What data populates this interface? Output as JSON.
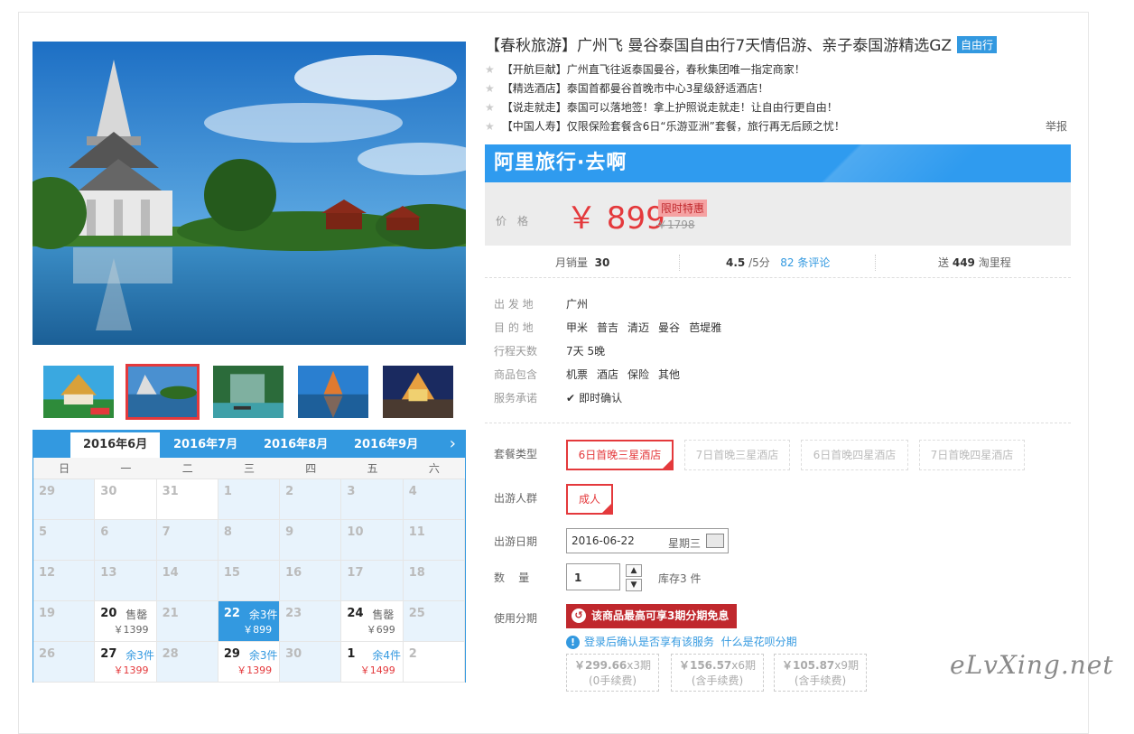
{
  "product": {
    "title": "【春秋旅游】广州飞 曼谷泰国自由行7天情侣游、亲子泰国游精选GZ",
    "tag": "自由行",
    "features": [
      "【开航巨献】广州直飞往返泰国曼谷，春秋集团唯一指定商家！",
      "【精选酒店】泰国首都曼谷首晚市中心3星级舒适酒店！",
      "【说走就走】泰国可以落地签！拿上护照说走就走！让自由行更自由！",
      "【中国人寿】仅限保险套餐含6日“乐游亚洲”套餐，旅行再无后顾之忧！"
    ],
    "report_label": "举报"
  },
  "brand": {
    "name": "阿里旅行·去啊"
  },
  "price": {
    "label": "价格",
    "value": "￥ 899",
    "promo": "限时特惠",
    "original": "￥1798"
  },
  "stats": {
    "sales_label": "月销量",
    "sales": "30",
    "rating": "4.5",
    "rating_max": "/5分",
    "reviews": "82 条评论",
    "miles_prefix": "送",
    "miles": "449",
    "miles_suffix": "淘里程"
  },
  "info": [
    {
      "label": "出 发 地",
      "values": [
        "广州"
      ]
    },
    {
      "label": "目 的 地",
      "values": [
        "甲米",
        "普吉",
        "清迈",
        "曼谷",
        "芭堤雅"
      ]
    },
    {
      "label": "行程天数",
      "values": [
        "7天 5晚"
      ]
    },
    {
      "label": "商品包含",
      "values": [
        "机票",
        "酒店",
        "保险",
        "其他"
      ]
    },
    {
      "label": "服务承诺",
      "values": [
        "即时确认"
      ]
    }
  ],
  "options": {
    "package_label": "套餐类型",
    "packages": [
      "6日首晚三星酒店",
      "7日首晚三星酒店",
      "6日首晚四星酒店",
      "7日首晚四星酒店"
    ],
    "people_label": "出游人群",
    "people": "成人",
    "date_label": "出游日期",
    "date": "2016-06-22",
    "weekday": "星期三",
    "qty_label": "数    量",
    "qty": "1",
    "stock": "库存3 件",
    "install_label": "使用分期",
    "install_btn": "该商品最高可享3期分期免息",
    "hint_text": "登录后确认是否享有该服务",
    "hint_link": "什么是花呗分期",
    "plans": [
      {
        "amount": "￥299.66",
        "term": "x3期",
        "fee": "(0手续费)"
      },
      {
        "amount": "￥156.57",
        "term": "x6期",
        "fee": "(含手续费)"
      },
      {
        "amount": "￥105.87",
        "term": "x9期",
        "fee": "(含手续费)"
      }
    ]
  },
  "calendar": {
    "months": [
      "2016年6月",
      "2016年7月",
      "2016年8月",
      "2016年9月"
    ],
    "next_icon": "chevron-right-icon",
    "weekdays": [
      "日",
      "一",
      "二",
      "三",
      "四",
      "五",
      "六"
    ],
    "cells": [
      {
        "d": "29",
        "off": true
      },
      {
        "d": "30",
        "off": false
      },
      {
        "d": "31",
        "off": false
      },
      {
        "d": "1",
        "off": true
      },
      {
        "d": "2",
        "off": true
      },
      {
        "d": "3",
        "off": true
      },
      {
        "d": "4",
        "off": true
      },
      {
        "d": "5",
        "off": true
      },
      {
        "d": "6",
        "off": true
      },
      {
        "d": "7",
        "off": true
      },
      {
        "d": "8",
        "off": true
      },
      {
        "d": "9",
        "off": true
      },
      {
        "d": "10",
        "off": true
      },
      {
        "d": "11",
        "off": true
      },
      {
        "d": "12",
        "off": true
      },
      {
        "d": "13",
        "off": true
      },
      {
        "d": "14",
        "off": true
      },
      {
        "d": "15",
        "off": true
      },
      {
        "d": "16",
        "off": true
      },
      {
        "d": "17",
        "off": true
      },
      {
        "d": "18",
        "off": true
      },
      {
        "d": "19",
        "off": true
      },
      {
        "d": "20",
        "avail": true,
        "status": "售罄",
        "price": "￥1399"
      },
      {
        "d": "21",
        "off": true
      },
      {
        "d": "22",
        "avail": true,
        "sel": true,
        "status": "余3件",
        "price": "￥899"
      },
      {
        "d": "23",
        "off": true
      },
      {
        "d": "24",
        "avail": true,
        "status": "售罄",
        "price": "￥699"
      },
      {
        "d": "25",
        "off": true
      },
      {
        "d": "26",
        "off": true
      },
      {
        "d": "27",
        "avail": true,
        "status": "余3件",
        "blue": true,
        "price": "￥1399",
        "red": true
      },
      {
        "d": "28",
        "off": true
      },
      {
        "d": "29",
        "avail": true,
        "status": "余3件",
        "blue": true,
        "price": "￥1399",
        "red": true
      },
      {
        "d": "30",
        "off": true
      },
      {
        "d": "1",
        "avail": true,
        "status": "余4件",
        "blue": true,
        "price": "￥1499",
        "red": true
      },
      {
        "d": "2",
        "off": false
      }
    ]
  },
  "watermark": "eLvXing.net",
  "colors": {
    "accent": "#3399e0",
    "price": "#e4393c",
    "brand_blue": "#2f9bef",
    "install_red": "#c0282d"
  }
}
